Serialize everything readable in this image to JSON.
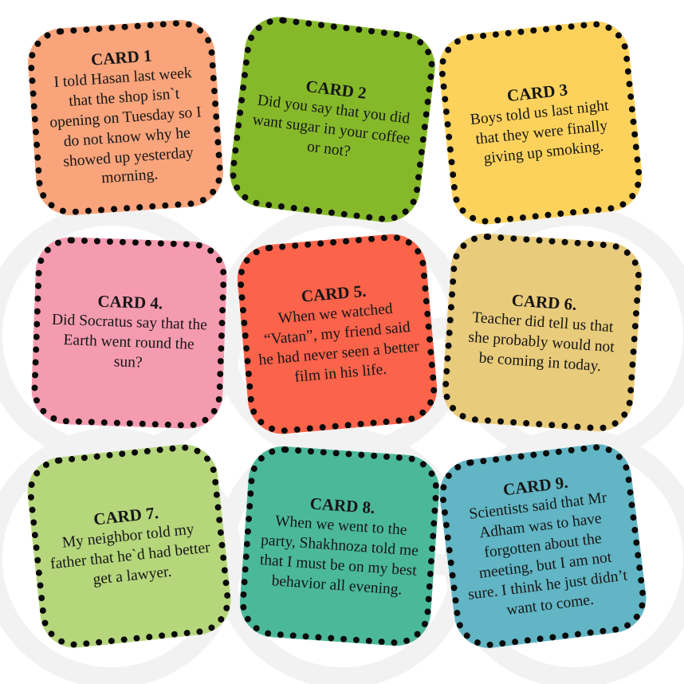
{
  "cards": [
    {
      "title": "CARD 1",
      "text": "I told Hasan last week that the shop isn`t opening on Tuesday so I do not know why he showed up yesterday morning.",
      "color": "#f9a47b"
    },
    {
      "title": "CARD 2",
      "text": "Did you say that you did want sugar in your coffee or not?",
      "color": "#86b92a"
    },
    {
      "title": "CARD 3",
      "text": "Boys told us last night that they were finally giving up smoking.",
      "color": "#fdd25c"
    },
    {
      "title": "CARD 4.",
      "text": "Did Socratus say that the Earth went round the sun?",
      "color": "#f59bb0"
    },
    {
      "title": "CARD 5.",
      "text": "When we watched “Vatan”, my friend said he had never seen a better film in his life.",
      "color": "#fb634b"
    },
    {
      "title": "CARD 6.",
      "text": "Teacher did tell us that she probably would not be coming in today.",
      "color": "#e8cb7b"
    },
    {
      "title": "CARD 7.",
      "text": "My neighbor told my father that he`d had better get a lawyer.",
      "color": "#b6d67c"
    },
    {
      "title": "CARD 8.",
      "text": "When we went to the party, Shakhnoza told me that I must be on my best behavior all evening.",
      "color": "#4bb89a"
    },
    {
      "title": "CARD 9.",
      "text": "Scientists said that Mr Adham was to have forgotten about the meeting, but I am not sure. I think he just didn’t want to come.",
      "color": "#62b5c4"
    }
  ]
}
